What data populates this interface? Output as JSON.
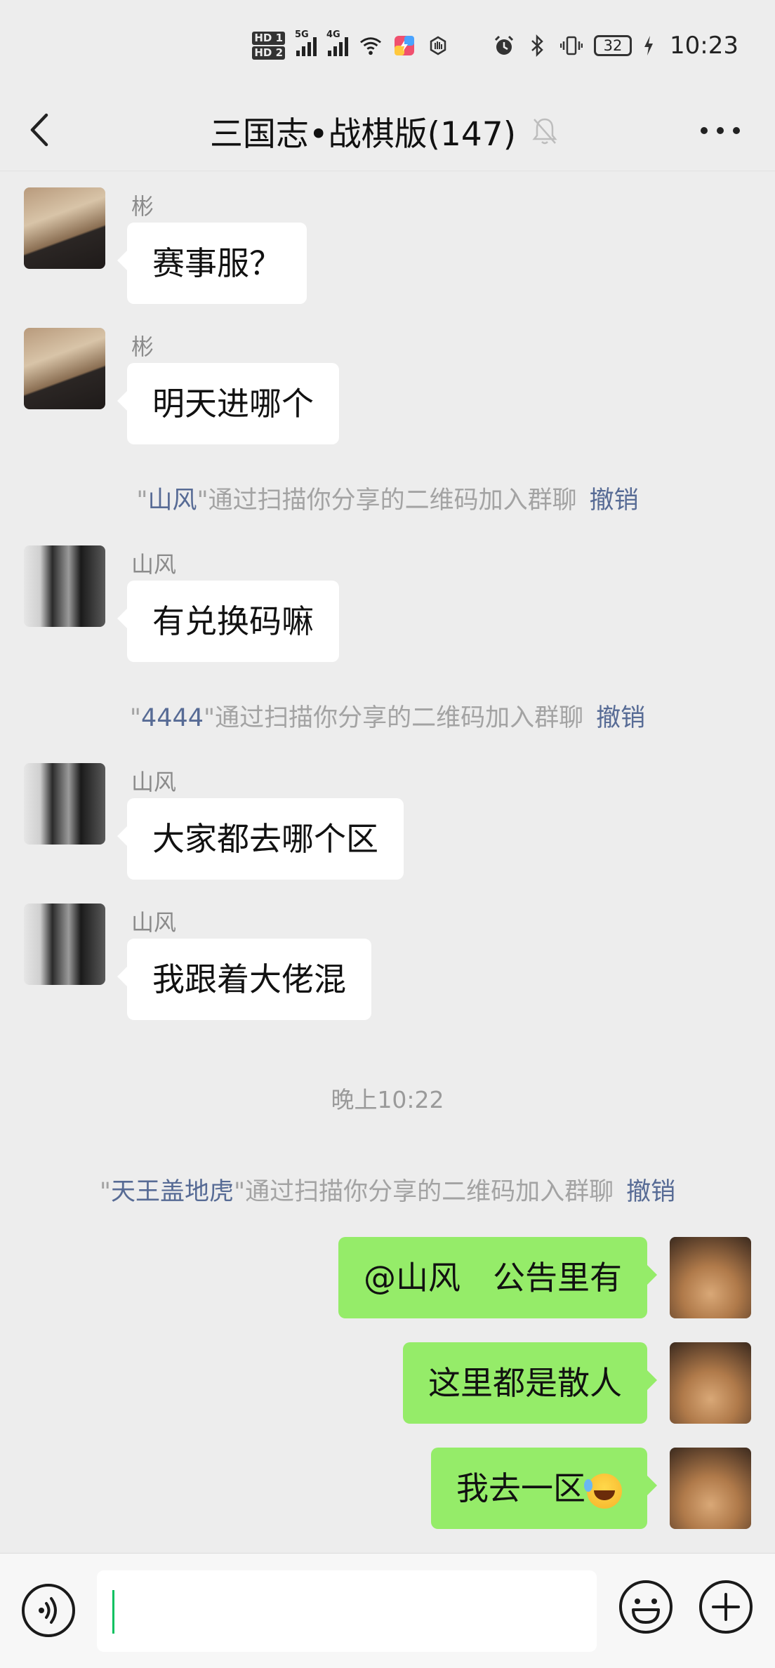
{
  "status_bar": {
    "hd1": "HD 1",
    "hd2": "HD 2",
    "net1": "5G",
    "net2": "4G",
    "battery": "32",
    "time": "10:23"
  },
  "header": {
    "title": "三国志•战棋版(147)"
  },
  "messages": [
    {
      "sender": "彬",
      "text": "赛事服？"
    },
    {
      "sender": "彬",
      "text": "明天进哪个"
    },
    {
      "sender": "山风",
      "text": "有兑换码嘛"
    },
    {
      "sender": "山风",
      "text": "大家都去哪个区"
    },
    {
      "sender": "山风",
      "text": "我跟着大佬混"
    }
  ],
  "system_notices": [
    {
      "name": "山风",
      "suffix": "\"通过扫描你分享的二维码加入群聊",
      "undo": "撤销"
    },
    {
      "name": "4444",
      "suffix": "\"通过扫描你分享的二维码加入群聊",
      "undo": "撤销"
    },
    {
      "name": "天王盖地虎",
      "suffix": "\"通过扫描你分享的二维码加入群聊",
      "undo": "撤销"
    }
  ],
  "quote_open": "\"",
  "timestamp": "晚上10:22",
  "my_messages": [
    {
      "text": "@山风　公告里有"
    },
    {
      "text": "这里都是散人"
    },
    {
      "text": "我去一区",
      "emoji": "laughing-tears"
    }
  ],
  "colors": {
    "incoming_bubble": "#ffffff",
    "outgoing_bubble": "#95ec69",
    "link": "#576b95",
    "background": "#ededed"
  }
}
